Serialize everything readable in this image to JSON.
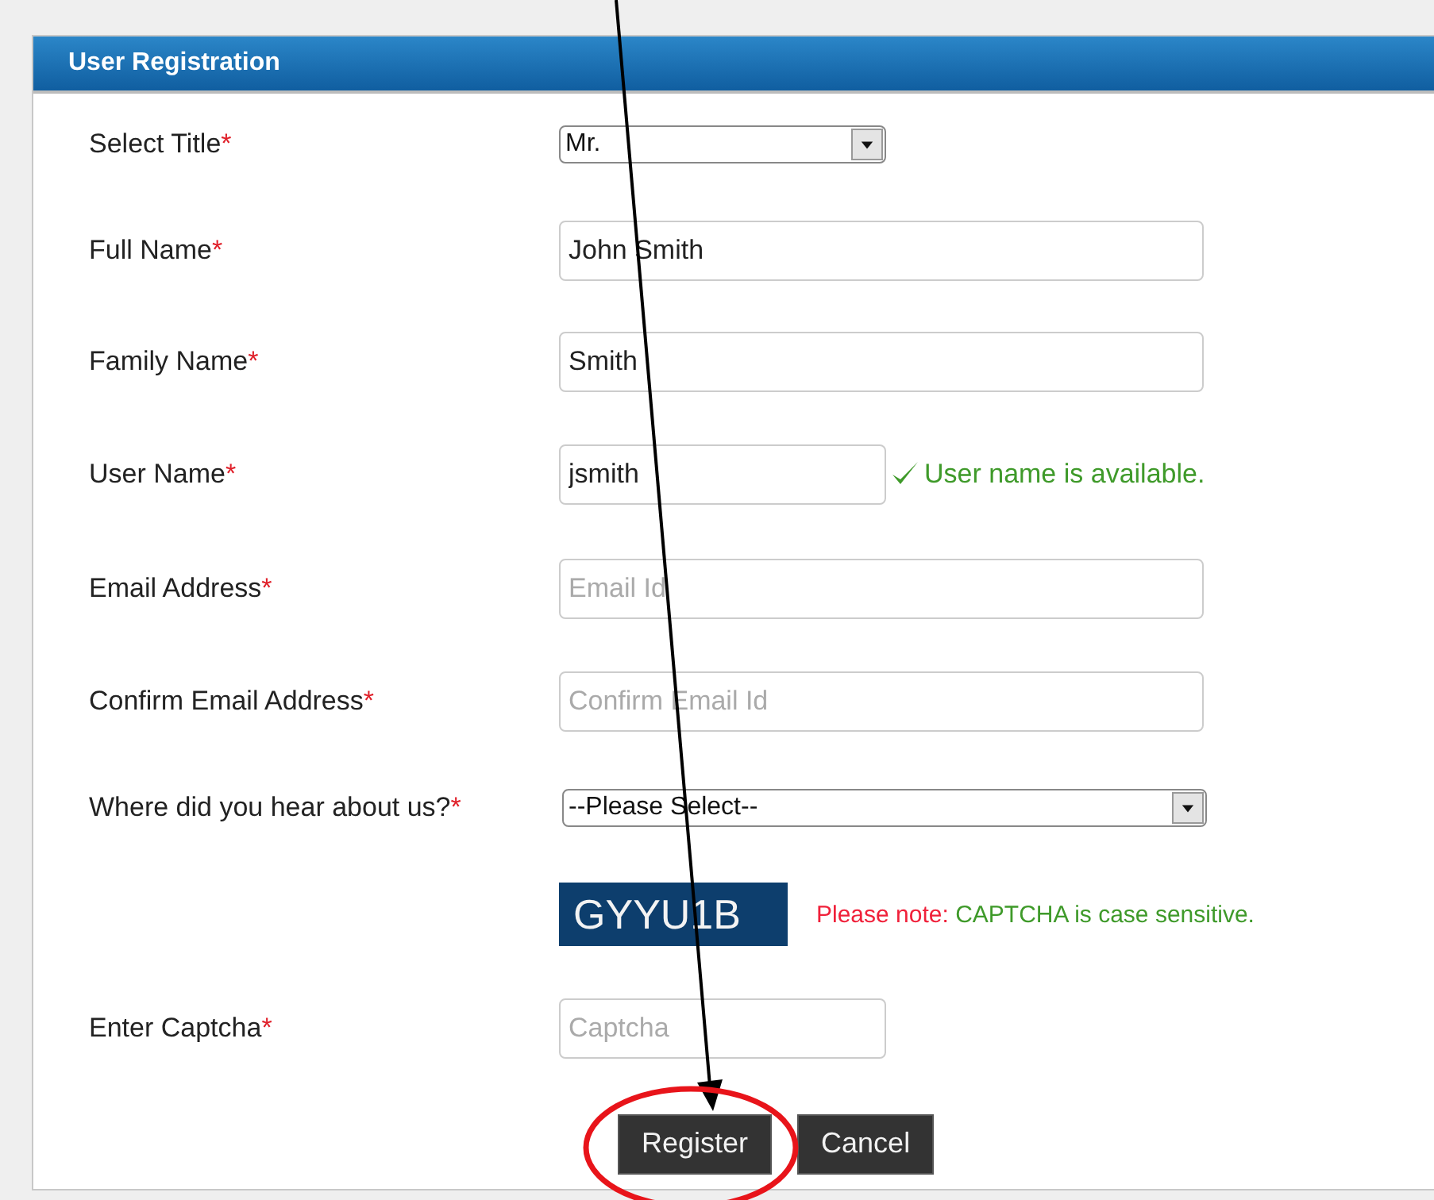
{
  "panel": {
    "title": "User Registration"
  },
  "fields": [
    {
      "kind": "short-select",
      "label": "Select Title",
      "required_mark": "*",
      "value": "Mr."
    },
    {
      "kind": "input",
      "label": "Full Name",
      "required_mark": "*",
      "value": "John Smith"
    },
    {
      "kind": "input",
      "label": "Family Name",
      "required_mark": "*",
      "value": "Smith"
    },
    {
      "kind": "short-input",
      "label": "User Name",
      "required_mark": "*",
      "value": "jsmith",
      "status": "User name is available."
    },
    {
      "kind": "input",
      "label": "Email Address",
      "required_mark": "*",
      "placeholder": "Email Id"
    },
    {
      "kind": "input",
      "label": "Confirm Email Address",
      "required_mark": "*",
      "placeholder": "Confirm Email Id"
    },
    {
      "kind": "select",
      "label": "Where did you hear about us?",
      "required_mark": "*",
      "value": "--Please Select--"
    },
    {
      "kind": "captcha",
      "code": "GYYU1B",
      "note_label": "Please note:",
      "note_text": "CAPTCHA is case sensitive."
    },
    {
      "kind": "short-input",
      "label": "Enter Captcha",
      "required_mark": "*",
      "placeholder": "Captcha"
    }
  ],
  "buttons": [
    {
      "label": "Register",
      "highlighted": true
    },
    {
      "label": "Cancel",
      "highlighted": false
    }
  ]
}
